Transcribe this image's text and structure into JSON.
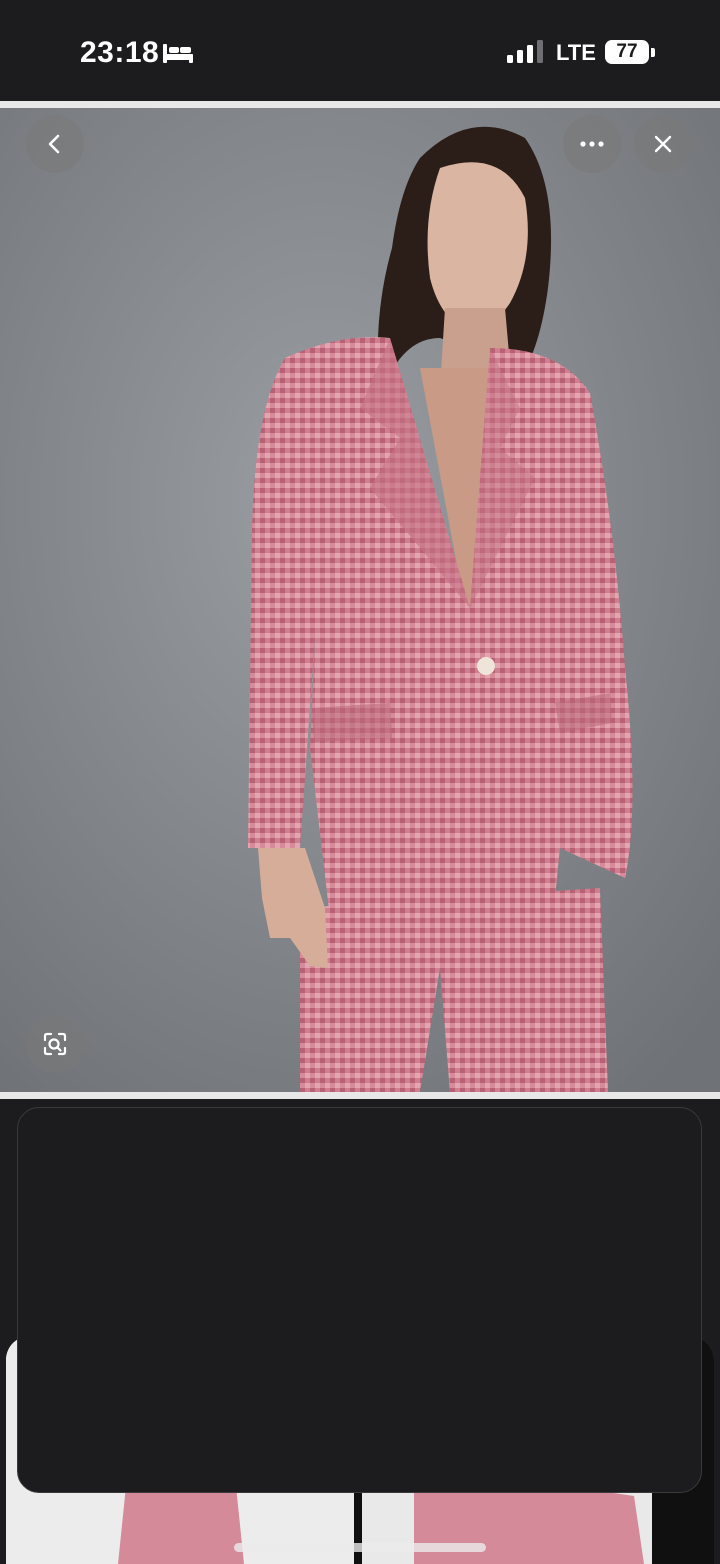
{
  "status_bar": {
    "time": "23:18",
    "focus_icon": "bed-icon",
    "signal_icon": "cellular-signal-icon",
    "network": "LTE",
    "battery": "77"
  },
  "viewer": {
    "photo_subject": "model-in-pink-gingham-suit",
    "buttons": {
      "back_icon": "chevron-left-icon",
      "more_icon": "ellipsis-icon",
      "close_icon": "close-icon",
      "lens_icon": "visual-search-icon"
    }
  },
  "colors": {
    "background": "#1c1c1e",
    "photo_backdrop": "#7d8185",
    "suit_pink": "#d58a99"
  }
}
